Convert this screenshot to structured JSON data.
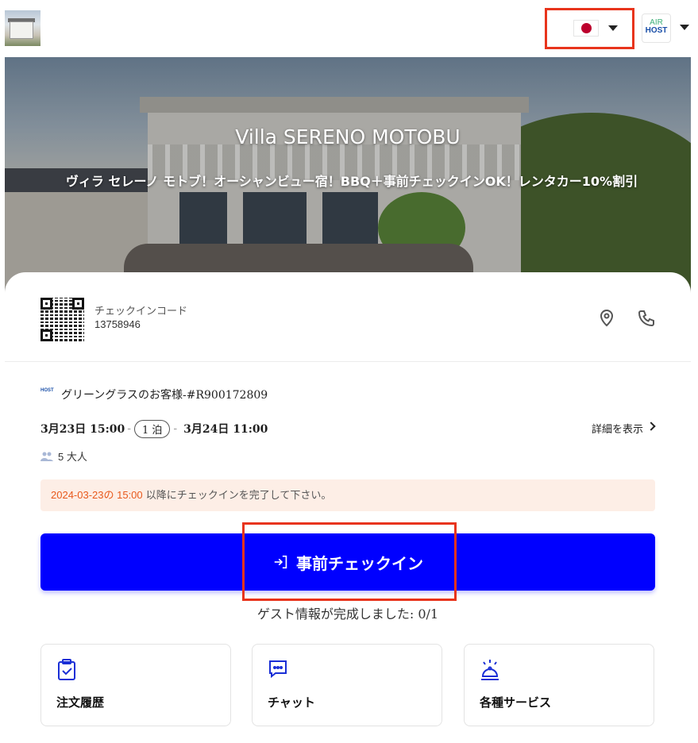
{
  "header": {
    "language_flag": "japan-flag-icon",
    "logo_text_top": "AIR",
    "logo_text_bottom": "HOST",
    "brand_color": "#1a4fa8",
    "highlight_color": "#e8341c"
  },
  "hero": {
    "title": "Villa SERENO MOTOBU",
    "subtitle": "ヴィラ セレーノ モトブ！オーシャンビュー宿！BBQ＋事前チェックインOK！レンタカー10%割引"
  },
  "checkin": {
    "code_label": "チェックインコード",
    "code_value": "13758946"
  },
  "booking": {
    "guest_logo": "HOST",
    "guest_line": "グリーングラスのお客様-#R900172809",
    "checkin_date": "3月23日 15:00",
    "nights": "1 泊",
    "checkout_date": "3月24日 11:00",
    "details_link": "詳細を表示",
    "people": "5  大人"
  },
  "notice": {
    "highlight": "2024-03-23の 15:00",
    "text": " 以降にチェックインを完了して下さい。"
  },
  "cta": {
    "label": "事前チェックイン",
    "color": "#0000ff"
  },
  "progress": {
    "text": "ゲスト情報が完成しました: 0/1"
  },
  "tiles": [
    {
      "label": "注文履歴",
      "icon": "clipboard-check-icon"
    },
    {
      "label": "チャット",
      "icon": "chat-icon"
    },
    {
      "label": "各種サービス",
      "icon": "service-bell-icon"
    }
  ]
}
